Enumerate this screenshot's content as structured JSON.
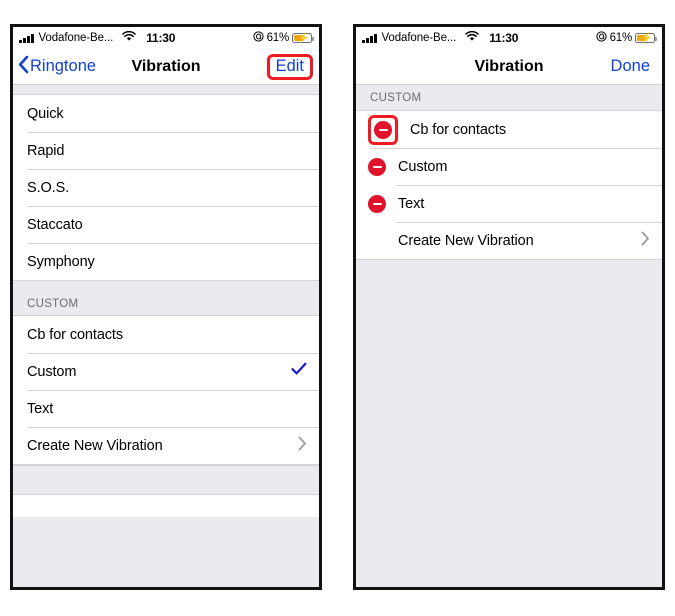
{
  "status_bar": {
    "carrier": "Vodafone-Be...",
    "time": "11:30",
    "battery_percent": "61%",
    "wifi_icon": "wifi-icon",
    "signal_icon": "cellular-signal-icon",
    "location_icon": "location-services-icon",
    "battery_icon": "battery-charging-icon",
    "battery_fill_color": "#f0a30a"
  },
  "left_phone": {
    "nav": {
      "back_label": "Ringtone",
      "back_icon": "chevron-left-icon",
      "title": "Vibration",
      "action_label": "Edit",
      "highlight_color": "#ee1c22",
      "tint_color": "#1240d8"
    },
    "standard_section": {
      "rows": [
        {
          "label": "Quick",
          "selected": false
        },
        {
          "label": "Rapid",
          "selected": false
        },
        {
          "label": "S.O.S.",
          "selected": false
        },
        {
          "label": "Staccato",
          "selected": false
        },
        {
          "label": "Symphony",
          "selected": false
        }
      ]
    },
    "custom_section": {
      "header": "CUSTOM",
      "rows": [
        {
          "label": "Cb for contacts",
          "accessory": "none"
        },
        {
          "label": "Custom",
          "accessory": "checkmark"
        },
        {
          "label": "Text",
          "accessory": "none"
        },
        {
          "label": "Create New Vibration",
          "accessory": "chevron"
        }
      ]
    }
  },
  "right_phone": {
    "nav": {
      "title": "Vibration",
      "action_label": "Done",
      "tint_color": "#1240d8"
    },
    "custom_section": {
      "header": "CUSTOM",
      "rows": [
        {
          "label": "Cb for contacts",
          "delete_icon": "delete-minus-icon",
          "highlighted": true,
          "accessory": "none"
        },
        {
          "label": "Custom",
          "delete_icon": "delete-minus-icon",
          "highlighted": false,
          "accessory": "none"
        },
        {
          "label": "Text",
          "delete_icon": "delete-minus-icon",
          "highlighted": false,
          "accessory": "none"
        },
        {
          "label": "Create New Vibration",
          "delete_icon": "none",
          "highlighted": false,
          "accessory": "chevron"
        }
      ]
    },
    "highlight_color": "#ee1c22",
    "delete_button_color": "#e0122c"
  }
}
